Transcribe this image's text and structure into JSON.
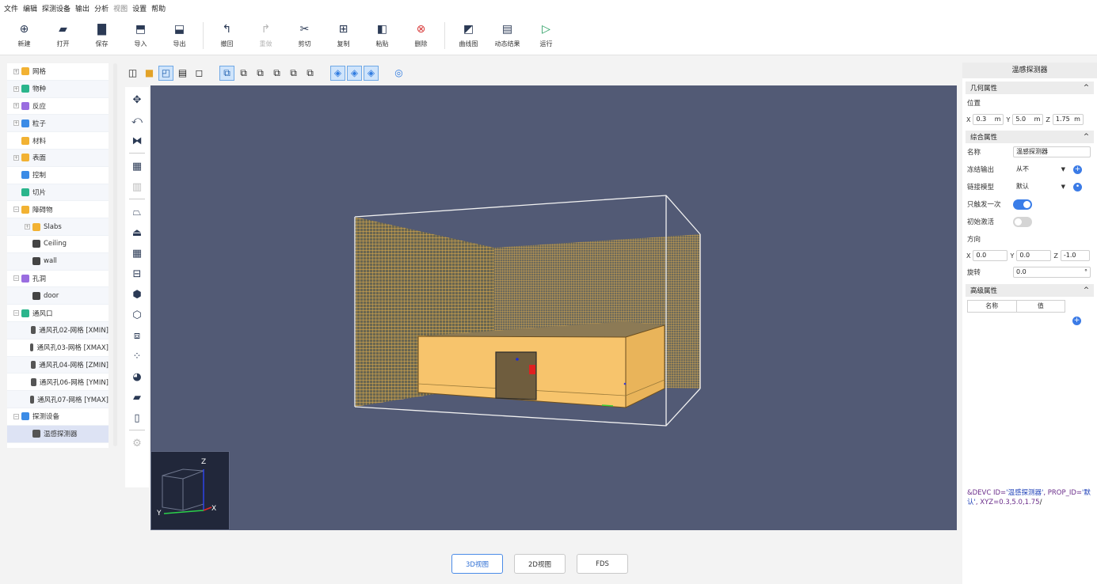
{
  "menu": [
    "文件",
    "编辑",
    "探测设备",
    "输出",
    "分析",
    "视图",
    "设置",
    "帮助"
  ],
  "toolbar": [
    {
      "label": "新建",
      "icon": "plus-circle-icon",
      "glyph": "⊕"
    },
    {
      "label": "打开",
      "icon": "folder-open-icon",
      "glyph": "▰"
    },
    {
      "label": "保存",
      "icon": "save-icon",
      "glyph": "▇"
    },
    {
      "label": "导入",
      "icon": "import-icon",
      "glyph": "⬒"
    },
    {
      "label": "导出",
      "icon": "export-icon",
      "glyph": "⬓"
    },
    {
      "label": "撤回",
      "icon": "undo-icon",
      "glyph": "↰"
    },
    {
      "label": "重做",
      "icon": "redo-icon",
      "glyph": "↱"
    },
    {
      "label": "剪切",
      "icon": "scissors-icon",
      "glyph": "✂"
    },
    {
      "label": "复制",
      "icon": "copy-icon",
      "glyph": "⊞"
    },
    {
      "label": "粘贴",
      "icon": "paste-icon",
      "glyph": "◧"
    },
    {
      "label": "删除",
      "icon": "delete-icon",
      "glyph": "⊗"
    },
    {
      "label": "曲线图",
      "icon": "line-chart-icon",
      "glyph": "◩"
    },
    {
      "label": "动态结果",
      "icon": "dynamic-result-icon",
      "glyph": "▤"
    },
    {
      "label": "运行",
      "icon": "run-icon",
      "glyph": "▷"
    }
  ],
  "tree": [
    {
      "label": "网格",
      "level": 0,
      "expander": "+",
      "color": "#f2b233"
    },
    {
      "label": "物种",
      "level": 0,
      "expander": "+",
      "color": "#2bb58c"
    },
    {
      "label": "反应",
      "level": 0,
      "expander": "+",
      "color": "#9a6de0"
    },
    {
      "label": "粒子",
      "level": 0,
      "expander": "+",
      "color": "#3b8be6"
    },
    {
      "label": "材料",
      "level": 0,
      "expander": "",
      "color": "#f2b233"
    },
    {
      "label": "表面",
      "level": 0,
      "expander": "+",
      "color": "#f2b233"
    },
    {
      "label": "控制",
      "level": 0,
      "expander": "",
      "color": "#3b8be6"
    },
    {
      "label": "切片",
      "level": 0,
      "expander": "",
      "color": "#2bb58c"
    },
    {
      "label": "障碍物",
      "level": 0,
      "expander": "−",
      "color": "#f2b233"
    },
    {
      "label": "Slabs",
      "level": 1,
      "expander": "+",
      "color": "#f2b233"
    },
    {
      "label": "Ceiling",
      "level": 1,
      "expander": "",
      "color": "#444444"
    },
    {
      "label": "wall",
      "level": 1,
      "expander": "",
      "color": "#444444"
    },
    {
      "label": "孔洞",
      "level": 0,
      "expander": "−",
      "color": "#9a6de0"
    },
    {
      "label": "door",
      "level": 1,
      "expander": "",
      "color": "#444444"
    },
    {
      "label": "通风口",
      "level": 0,
      "expander": "−",
      "color": "#2bb58c"
    },
    {
      "label": "通风孔02-网格 [XMIN]",
      "level": 1,
      "expander": "",
      "color": "#555555"
    },
    {
      "label": "通风孔03-网格 [XMAX]",
      "level": 1,
      "expander": "",
      "color": "#555555"
    },
    {
      "label": "通风孔04-网格 [ZMIN]",
      "level": 1,
      "expander": "",
      "color": "#555555"
    },
    {
      "label": "通风孔06-网格 [YMIN]",
      "level": 1,
      "expander": "",
      "color": "#555555"
    },
    {
      "label": "通风孔07-网格 [YMAX]",
      "level": 1,
      "expander": "",
      "color": "#555555"
    },
    {
      "label": "探测设备",
      "level": 0,
      "expander": "−",
      "color": "#3b8be6"
    },
    {
      "label": "温感探测器",
      "level": 1,
      "expander": "",
      "color": "#555555",
      "selected": true
    }
  ],
  "tabs": {
    "view3d": "3D视图",
    "view2d": "2D视图",
    "fds": "FDS"
  },
  "axes": {
    "x": "X",
    "y": "Y",
    "z": "Z"
  },
  "panel": {
    "title": "温感探测器",
    "geo_title": "几何属性",
    "position_label": "位置",
    "pos": {
      "x": "0.3",
      "y": "5.0",
      "z": "1.75",
      "unit": "m"
    },
    "general_title": "综合属性",
    "name_label": "名称",
    "name_value": "温感探测器",
    "freeze_label": "冻结输出",
    "freeze_value": "从不",
    "link_label": "链接模型",
    "link_value": "默认",
    "once_label": "只触发一次",
    "init_label": "初始激活",
    "dir_label": "方向",
    "dir": {
      "x": "0.0",
      "y": "0.0",
      "z": "-1.0"
    },
    "rot_label": "旋转",
    "rot_value": "0.0",
    "rot_unit": "°",
    "adv_title": "高级属性",
    "adv_col_name": "名称",
    "adv_col_value": "值",
    "collapse": "^",
    "once_on": true,
    "init_on": false
  },
  "code": {
    "p1": "&DEVC ID=",
    "id": "'温感探测器'",
    "p2": ", PROP_ID=",
    "prop": "'默认'",
    "p3": ", XYZ=0.3,5.0,1.75",
    "end": "/"
  },
  "colors": {
    "viewport_bg": "#525a75",
    "accent": "#3b7be6",
    "box_fill": "#f7c46c"
  }
}
